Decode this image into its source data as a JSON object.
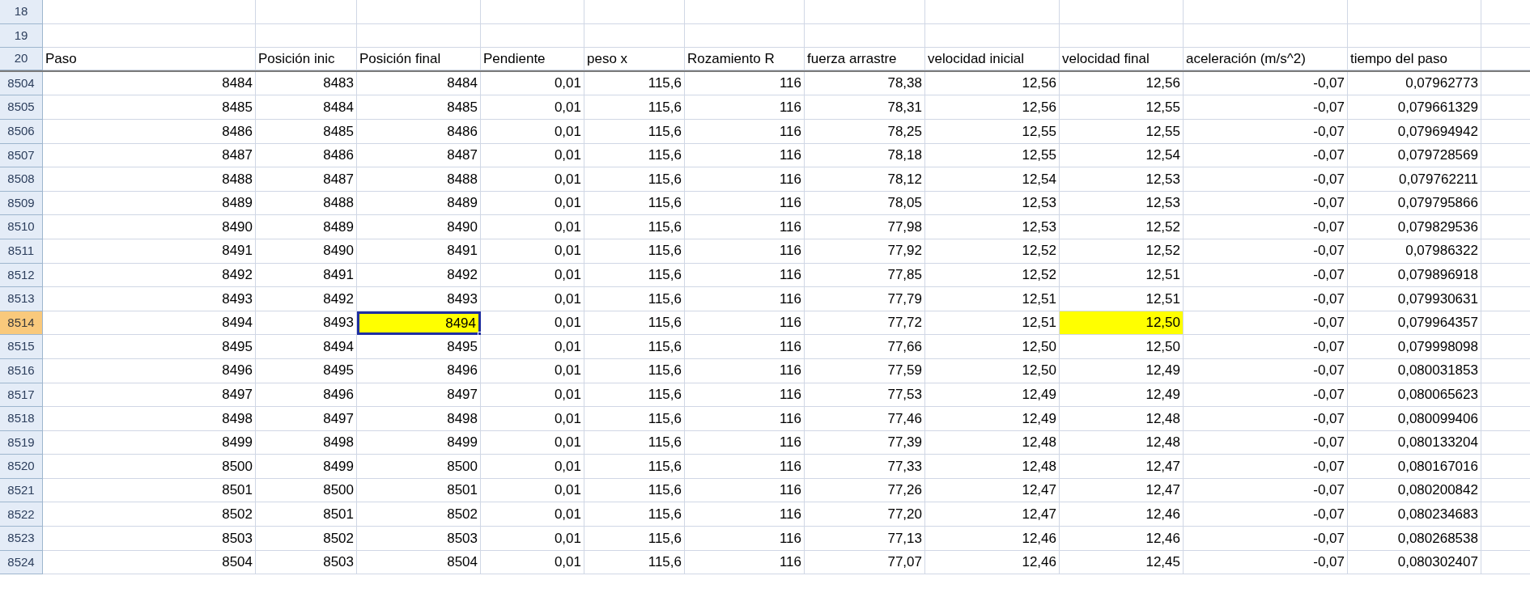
{
  "sheet": {
    "rows": [
      {
        "kind": "blank",
        "number": "18",
        "selected": false
      },
      {
        "kind": "blank",
        "number": "19",
        "selected": false
      },
      {
        "kind": "header",
        "number": "20",
        "selected": false,
        "cells": [
          "Paso",
          "Posición inic",
          "Posición final",
          "Pendiente",
          "peso x",
          "Rozamiento R",
          "fuerza arrastre",
          "velocidad inicial",
          "velocidad final",
          "aceleración (m/s^2)",
          "tiempo del paso"
        ]
      },
      {
        "kind": "data",
        "number": "8504",
        "selected": false,
        "cells": [
          "8484",
          "8483",
          "8484",
          "0,01",
          "115,6",
          "116",
          "78,38",
          "12,56",
          "12,56",
          "-0,07",
          "0,07962773"
        ],
        "highlighted": [
          false,
          false,
          false,
          false,
          false,
          false,
          false,
          false,
          false,
          false,
          false
        ],
        "active": [
          false,
          false,
          false,
          false,
          false,
          false,
          false,
          false,
          false,
          false,
          false
        ]
      },
      {
        "kind": "data",
        "number": "8505",
        "selected": false,
        "cells": [
          "8485",
          "8484",
          "8485",
          "0,01",
          "115,6",
          "116",
          "78,31",
          "12,56",
          "12,55",
          "-0,07",
          "0,079661329"
        ],
        "highlighted": [
          false,
          false,
          false,
          false,
          false,
          false,
          false,
          false,
          false,
          false,
          false
        ],
        "active": [
          false,
          false,
          false,
          false,
          false,
          false,
          false,
          false,
          false,
          false,
          false
        ]
      },
      {
        "kind": "data",
        "number": "8506",
        "selected": false,
        "cells": [
          "8486",
          "8485",
          "8486",
          "0,01",
          "115,6",
          "116",
          "78,25",
          "12,55",
          "12,55",
          "-0,07",
          "0,079694942"
        ],
        "highlighted": [
          false,
          false,
          false,
          false,
          false,
          false,
          false,
          false,
          false,
          false,
          false
        ],
        "active": [
          false,
          false,
          false,
          false,
          false,
          false,
          false,
          false,
          false,
          false,
          false
        ]
      },
      {
        "kind": "data",
        "number": "8507",
        "selected": false,
        "cells": [
          "8487",
          "8486",
          "8487",
          "0,01",
          "115,6",
          "116",
          "78,18",
          "12,55",
          "12,54",
          "-0,07",
          "0,079728569"
        ],
        "highlighted": [
          false,
          false,
          false,
          false,
          false,
          false,
          false,
          false,
          false,
          false,
          false
        ],
        "active": [
          false,
          false,
          false,
          false,
          false,
          false,
          false,
          false,
          false,
          false,
          false
        ]
      },
      {
        "kind": "data",
        "number": "8508",
        "selected": false,
        "cells": [
          "8488",
          "8487",
          "8488",
          "0,01",
          "115,6",
          "116",
          "78,12",
          "12,54",
          "12,53",
          "-0,07",
          "0,079762211"
        ],
        "highlighted": [
          false,
          false,
          false,
          false,
          false,
          false,
          false,
          false,
          false,
          false,
          false
        ],
        "active": [
          false,
          false,
          false,
          false,
          false,
          false,
          false,
          false,
          false,
          false,
          false
        ]
      },
      {
        "kind": "data",
        "number": "8509",
        "selected": false,
        "cells": [
          "8489",
          "8488",
          "8489",
          "0,01",
          "115,6",
          "116",
          "78,05",
          "12,53",
          "12,53",
          "-0,07",
          "0,079795866"
        ],
        "highlighted": [
          false,
          false,
          false,
          false,
          false,
          false,
          false,
          false,
          false,
          false,
          false
        ],
        "active": [
          false,
          false,
          false,
          false,
          false,
          false,
          false,
          false,
          false,
          false,
          false
        ]
      },
      {
        "kind": "data",
        "number": "8510",
        "selected": false,
        "cells": [
          "8490",
          "8489",
          "8490",
          "0,01",
          "115,6",
          "116",
          "77,98",
          "12,53",
          "12,52",
          "-0,07",
          "0,079829536"
        ],
        "highlighted": [
          false,
          false,
          false,
          false,
          false,
          false,
          false,
          false,
          false,
          false,
          false
        ],
        "active": [
          false,
          false,
          false,
          false,
          false,
          false,
          false,
          false,
          false,
          false,
          false
        ]
      },
      {
        "kind": "data",
        "number": "8511",
        "selected": false,
        "cells": [
          "8491",
          "8490",
          "8491",
          "0,01",
          "115,6",
          "116",
          "77,92",
          "12,52",
          "12,52",
          "-0,07",
          "0,07986322"
        ],
        "highlighted": [
          false,
          false,
          false,
          false,
          false,
          false,
          false,
          false,
          false,
          false,
          false
        ],
        "active": [
          false,
          false,
          false,
          false,
          false,
          false,
          false,
          false,
          false,
          false,
          false
        ]
      },
      {
        "kind": "data",
        "number": "8512",
        "selected": false,
        "cells": [
          "8492",
          "8491",
          "8492",
          "0,01",
          "115,6",
          "116",
          "77,85",
          "12,52",
          "12,51",
          "-0,07",
          "0,079896918"
        ],
        "highlighted": [
          false,
          false,
          false,
          false,
          false,
          false,
          false,
          false,
          false,
          false,
          false
        ],
        "active": [
          false,
          false,
          false,
          false,
          false,
          false,
          false,
          false,
          false,
          false,
          false
        ]
      },
      {
        "kind": "data",
        "number": "8513",
        "selected": false,
        "cells": [
          "8493",
          "8492",
          "8493",
          "0,01",
          "115,6",
          "116",
          "77,79",
          "12,51",
          "12,51",
          "-0,07",
          "0,079930631"
        ],
        "highlighted": [
          false,
          false,
          false,
          false,
          false,
          false,
          false,
          false,
          false,
          false,
          false
        ],
        "active": [
          false,
          false,
          false,
          false,
          false,
          false,
          false,
          false,
          false,
          false,
          false
        ]
      },
      {
        "kind": "data",
        "number": "8514",
        "selected": true,
        "cells": [
          "8494",
          "8493",
          "8494",
          "0,01",
          "115,6",
          "116",
          "77,72",
          "12,51",
          "12,50",
          "-0,07",
          "0,079964357"
        ],
        "highlighted": [
          false,
          false,
          true,
          false,
          false,
          false,
          false,
          false,
          true,
          false,
          false
        ],
        "active": [
          false,
          false,
          true,
          false,
          false,
          false,
          false,
          false,
          false,
          false,
          false
        ]
      },
      {
        "kind": "data",
        "number": "8515",
        "selected": false,
        "cells": [
          "8495",
          "8494",
          "8495",
          "0,01",
          "115,6",
          "116",
          "77,66",
          "12,50",
          "12,50",
          "-0,07",
          "0,079998098"
        ],
        "highlighted": [
          false,
          false,
          false,
          false,
          false,
          false,
          false,
          false,
          false,
          false,
          false
        ],
        "active": [
          false,
          false,
          false,
          false,
          false,
          false,
          false,
          false,
          false,
          false,
          false
        ]
      },
      {
        "kind": "data",
        "number": "8516",
        "selected": false,
        "cells": [
          "8496",
          "8495",
          "8496",
          "0,01",
          "115,6",
          "116",
          "77,59",
          "12,50",
          "12,49",
          "-0,07",
          "0,080031853"
        ],
        "highlighted": [
          false,
          false,
          false,
          false,
          false,
          false,
          false,
          false,
          false,
          false,
          false
        ],
        "active": [
          false,
          false,
          false,
          false,
          false,
          false,
          false,
          false,
          false,
          false,
          false
        ]
      },
      {
        "kind": "data",
        "number": "8517",
        "selected": false,
        "cells": [
          "8497",
          "8496",
          "8497",
          "0,01",
          "115,6",
          "116",
          "77,53",
          "12,49",
          "12,49",
          "-0,07",
          "0,080065623"
        ],
        "highlighted": [
          false,
          false,
          false,
          false,
          false,
          false,
          false,
          false,
          false,
          false,
          false
        ],
        "active": [
          false,
          false,
          false,
          false,
          false,
          false,
          false,
          false,
          false,
          false,
          false
        ]
      },
      {
        "kind": "data",
        "number": "8518",
        "selected": false,
        "cells": [
          "8498",
          "8497",
          "8498",
          "0,01",
          "115,6",
          "116",
          "77,46",
          "12,49",
          "12,48",
          "-0,07",
          "0,080099406"
        ],
        "highlighted": [
          false,
          false,
          false,
          false,
          false,
          false,
          false,
          false,
          false,
          false,
          false
        ],
        "active": [
          false,
          false,
          false,
          false,
          false,
          false,
          false,
          false,
          false,
          false,
          false
        ]
      },
      {
        "kind": "data",
        "number": "8519",
        "selected": false,
        "cells": [
          "8499",
          "8498",
          "8499",
          "0,01",
          "115,6",
          "116",
          "77,39",
          "12,48",
          "12,48",
          "-0,07",
          "0,080133204"
        ],
        "highlighted": [
          false,
          false,
          false,
          false,
          false,
          false,
          false,
          false,
          false,
          false,
          false
        ],
        "active": [
          false,
          false,
          false,
          false,
          false,
          false,
          false,
          false,
          false,
          false,
          false
        ]
      },
      {
        "kind": "data",
        "number": "8520",
        "selected": false,
        "cells": [
          "8500",
          "8499",
          "8500",
          "0,01",
          "115,6",
          "116",
          "77,33",
          "12,48",
          "12,47",
          "-0,07",
          "0,080167016"
        ],
        "highlighted": [
          false,
          false,
          false,
          false,
          false,
          false,
          false,
          false,
          false,
          false,
          false
        ],
        "active": [
          false,
          false,
          false,
          false,
          false,
          false,
          false,
          false,
          false,
          false,
          false
        ]
      },
      {
        "kind": "data",
        "number": "8521",
        "selected": false,
        "cells": [
          "8501",
          "8500",
          "8501",
          "0,01",
          "115,6",
          "116",
          "77,26",
          "12,47",
          "12,47",
          "-0,07",
          "0,080200842"
        ],
        "highlighted": [
          false,
          false,
          false,
          false,
          false,
          false,
          false,
          false,
          false,
          false,
          false
        ],
        "active": [
          false,
          false,
          false,
          false,
          false,
          false,
          false,
          false,
          false,
          false,
          false
        ]
      },
      {
        "kind": "data",
        "number": "8522",
        "selected": false,
        "cells": [
          "8502",
          "8501",
          "8502",
          "0,01",
          "115,6",
          "116",
          "77,20",
          "12,47",
          "12,46",
          "-0,07",
          "0,080234683"
        ],
        "highlighted": [
          false,
          false,
          false,
          false,
          false,
          false,
          false,
          false,
          false,
          false,
          false
        ],
        "active": [
          false,
          false,
          false,
          false,
          false,
          false,
          false,
          false,
          false,
          false,
          false
        ]
      },
      {
        "kind": "data",
        "number": "8523",
        "selected": false,
        "cells": [
          "8503",
          "8502",
          "8503",
          "0,01",
          "115,6",
          "116",
          "77,13",
          "12,46",
          "12,46",
          "-0,07",
          "0,080268538"
        ],
        "highlighted": [
          false,
          false,
          false,
          false,
          false,
          false,
          false,
          false,
          false,
          false,
          false
        ],
        "active": [
          false,
          false,
          false,
          false,
          false,
          false,
          false,
          false,
          false,
          false,
          false
        ]
      },
      {
        "kind": "data",
        "number": "8524",
        "selected": false,
        "cells": [
          "8504",
          "8503",
          "8504",
          "0,01",
          "115,6",
          "116",
          "77,07",
          "12,46",
          "12,45",
          "-0,07",
          "0,080302407"
        ],
        "highlighted": [
          false,
          false,
          false,
          false,
          false,
          false,
          false,
          false,
          false,
          false,
          false
        ],
        "active": [
          false,
          false,
          false,
          false,
          false,
          false,
          false,
          false,
          false,
          false,
          false
        ]
      }
    ]
  }
}
